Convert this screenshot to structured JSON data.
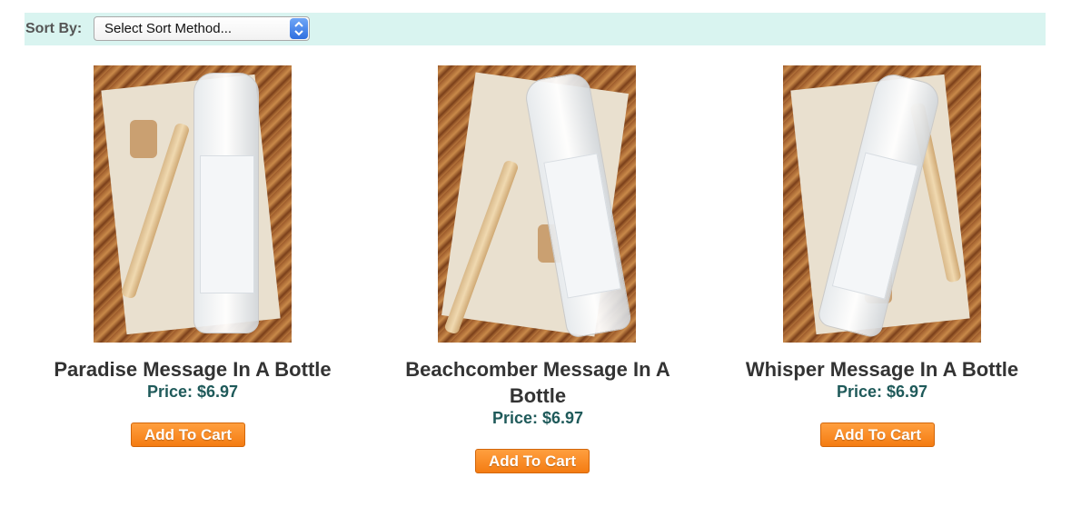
{
  "sort": {
    "label": "Sort By:",
    "selected": "Select Sort Method..."
  },
  "products": [
    {
      "image_alt": "",
      "title": "Paradise Message In A Bottle",
      "price": "Price: $6.97",
      "button": "Add To Cart"
    },
    {
      "image_alt": "",
      "title": "Beachcomber Message In A Bottle",
      "price": "Price: $6.97",
      "button": "Add To Cart"
    },
    {
      "image_alt": "",
      "title": "Whisper Message In A Bottle",
      "price": "Price: $6.97",
      "button": "Add To Cart"
    }
  ],
  "colors": {
    "sortbar_bg": "#d9f4f0",
    "title": "#333333",
    "price": "#1f5a5a",
    "button": "#f47c12"
  }
}
